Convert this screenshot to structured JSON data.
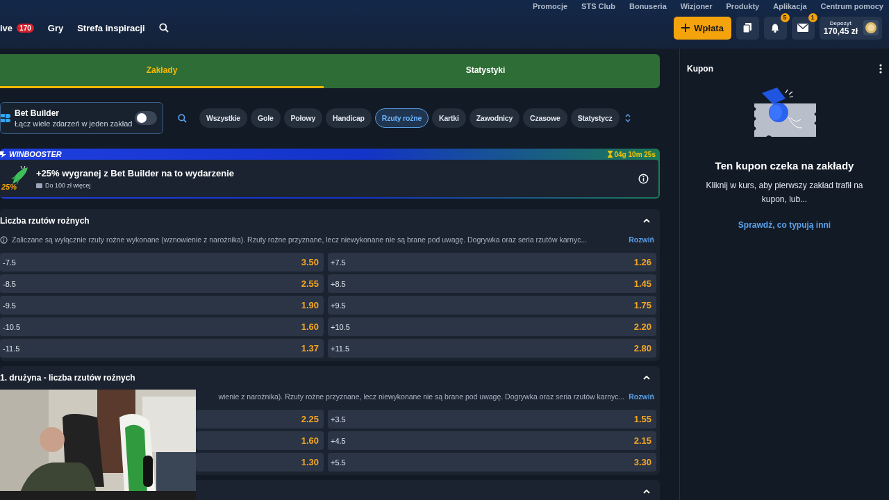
{
  "top_links": [
    "Promocje",
    "STS Club",
    "Bonuseria",
    "Wizjoner",
    "Produkty",
    "Aplikacja",
    "Centrum pomocy"
  ],
  "nav": [
    {
      "label": "ive",
      "badge": "170"
    },
    {
      "label": "Gry"
    },
    {
      "label": "Strefa inspiracji"
    }
  ],
  "actions": {
    "deposit": "Wpłata",
    "notifications_badge": "5",
    "messages_badge": "1",
    "balance_label": "Depozyt",
    "balance": "170,45 zł"
  },
  "tabs": [
    {
      "label": "Zakłady",
      "selected": true
    },
    {
      "label": "Statystyki",
      "selected": false
    }
  ],
  "bet_builder": {
    "title": "Bet Builder",
    "subtitle": "Łącz wiele zdarzeń w jeden zakład",
    "on": false
  },
  "filters": [
    {
      "label": "Wszystkie",
      "selected": false
    },
    {
      "label": "Gole",
      "selected": false
    },
    {
      "label": "Połowy",
      "selected": false
    },
    {
      "label": "Handicap",
      "selected": false
    },
    {
      "label": "Rzuty rożne",
      "selected": true
    },
    {
      "label": "Kartki",
      "selected": false
    },
    {
      "label": "Zawodnicy",
      "selected": false
    },
    {
      "label": "Czasowe",
      "selected": false
    },
    {
      "label": "Statystycz",
      "selected": false
    }
  ],
  "winbooster": {
    "logo": "WINBOOSTER",
    "timer": "04g 10m 25s",
    "badge": "25%",
    "title": "+25% wygranej z Bet Builder na to wydarzenie",
    "note": "Do 100 zł więcej"
  },
  "markets": [
    {
      "title": "Liczba rzutów rożnych",
      "expanded": true,
      "info_icon": true,
      "info": "Zaliczane są wyłącznie rzuty rożne wykonane (wznowienie z narożnika). Rzuty rożne przyznane, lecz niewykonane nie są brane pod uwagę. Dogrywka oraz seria rzutów karnyc...",
      "more": "Rozwiń",
      "rows": [
        {
          "left": {
            "label": "-7.5",
            "odds": "3.50"
          },
          "right": {
            "label": "+7.5",
            "odds": "1.26"
          }
        },
        {
          "left": {
            "label": "-8.5",
            "odds": "2.55"
          },
          "right": {
            "label": "+8.5",
            "odds": "1.45"
          }
        },
        {
          "left": {
            "label": "-9.5",
            "odds": "1.90"
          },
          "right": {
            "label": "+9.5",
            "odds": "1.75"
          }
        },
        {
          "left": {
            "label": "-10.5",
            "odds": "1.60"
          },
          "right": {
            "label": "+10.5",
            "odds": "2.20"
          }
        },
        {
          "left": {
            "label": "-11.5",
            "odds": "1.37"
          },
          "right": {
            "label": "+11.5",
            "odds": "2.80"
          }
        }
      ]
    },
    {
      "title": "1. drużyna - liczba rzutów rożnych",
      "expanded": true,
      "info_icon": false,
      "info": "wienie z narożnika). Rzuty rożne przyznane, lecz niewykonane nie są brane pod uwagę. Dogrywka oraz seria rzutów karnyc...",
      "more": "Rozwiń",
      "rows": [
        {
          "left": {
            "odds": "2.25"
          },
          "right": {
            "label": "+3.5",
            "odds": "1.55"
          }
        },
        {
          "left": {
            "odds": "1.60"
          },
          "right": {
            "label": "+4.5",
            "odds": "2.15"
          }
        },
        {
          "left": {
            "odds": "1.30"
          },
          "right": {
            "label": "+5.5",
            "odds": "3.30"
          }
        }
      ]
    },
    {
      "expanded": true
    }
  ],
  "coupon": {
    "title": "Kupon",
    "heading": "Ten kupon czeka na zakłady",
    "text": "Kliknij w kurs, aby pierwszy zakład trafił na kupon, lub...",
    "link": "Sprawdź, co typują inni"
  }
}
